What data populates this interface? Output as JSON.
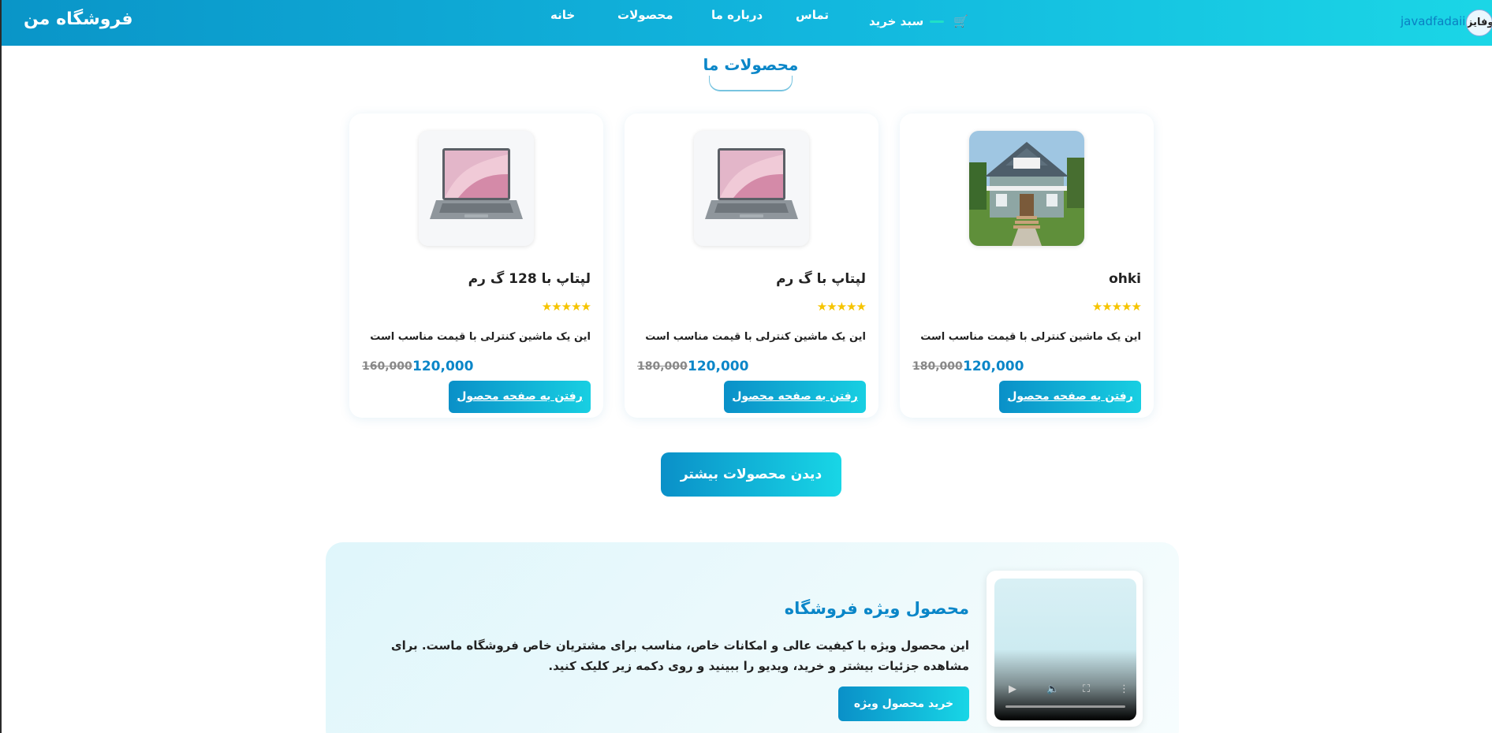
{
  "header": {
    "brand": "فروشگاه من",
    "nav": [
      "خانه",
      "محصولات",
      "درباره ما",
      "تماس"
    ],
    "cart_label": "سبد خرید",
    "username": "javadfadaii",
    "avatar_text": "وفایز",
    "colors": {
      "gradient_start": "#0a95c8",
      "gradient_end": "#1bd6e6"
    }
  },
  "products_section": {
    "title": "محصولات ما",
    "products": [
      {
        "title": "ohki",
        "rating": 5,
        "stars": "★★★★★",
        "description": "این یک ماشین کنترلی با قیمت مناسب است",
        "price": "120,000",
        "old_price": "180,000",
        "button": "رفتن به صفحه محصول",
        "image": "house"
      },
      {
        "title": "لپتاپ با گ رم",
        "rating": 5,
        "stars": "★★★★★",
        "description": "این یک ماشین کنترلی با قیمت مناسب است",
        "price": "120,000",
        "old_price": "180,000",
        "button": "رفتن به صفحه محصول",
        "image": "laptop"
      },
      {
        "title": "لپتاپ با 128 گ رم",
        "rating": 5,
        "stars": "★★★★★",
        "description": "این یک ماشین کنترلی با قیمت مناسب است",
        "price": "120,000",
        "old_price": "160,000",
        "button": "رفتن به صفحه محصول",
        "image": "laptop"
      }
    ],
    "more_button": "دیدن محصولات بیشتر"
  },
  "featured": {
    "title": "محصول ویژه فروشگاه",
    "text": "این محصول ویژه با کیفیت عالی و امکانات خاص، مناسب برای مشتریان خاص فروشگاه ماست. برای مشاهده جزئیات بیشتر و خرید، ویدیو را ببینید و روی دکمه زیر کلیک کنید.",
    "button": "خرید محصول ویژه"
  }
}
